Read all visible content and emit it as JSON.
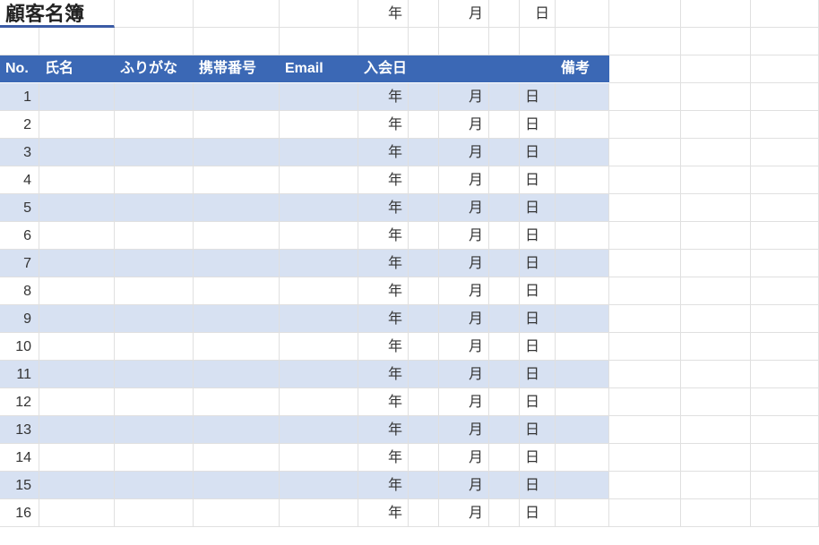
{
  "title": "顧客名簿",
  "topDate": {
    "year": "年",
    "month": "月",
    "day": "日"
  },
  "headers": {
    "no": "No.",
    "name": "氏名",
    "furigana": "ふりがな",
    "mobile": "携帯番号",
    "email": "Email",
    "joinDate": "入会日",
    "notes": "備考"
  },
  "dateUnits": {
    "year": "年",
    "month": "月",
    "day": "日"
  },
  "rows": [
    {
      "no": "1"
    },
    {
      "no": "2"
    },
    {
      "no": "3"
    },
    {
      "no": "4"
    },
    {
      "no": "5"
    },
    {
      "no": "6"
    },
    {
      "no": "7"
    },
    {
      "no": "8"
    },
    {
      "no": "9"
    },
    {
      "no": "10"
    },
    {
      "no": "11"
    },
    {
      "no": "12"
    },
    {
      "no": "13"
    },
    {
      "no": "14"
    },
    {
      "no": "15"
    },
    {
      "no": "16"
    }
  ],
  "cols": [
    44,
    84,
    88,
    96,
    88,
    56,
    34,
    56,
    34,
    40,
    60,
    80,
    78,
    76
  ]
}
